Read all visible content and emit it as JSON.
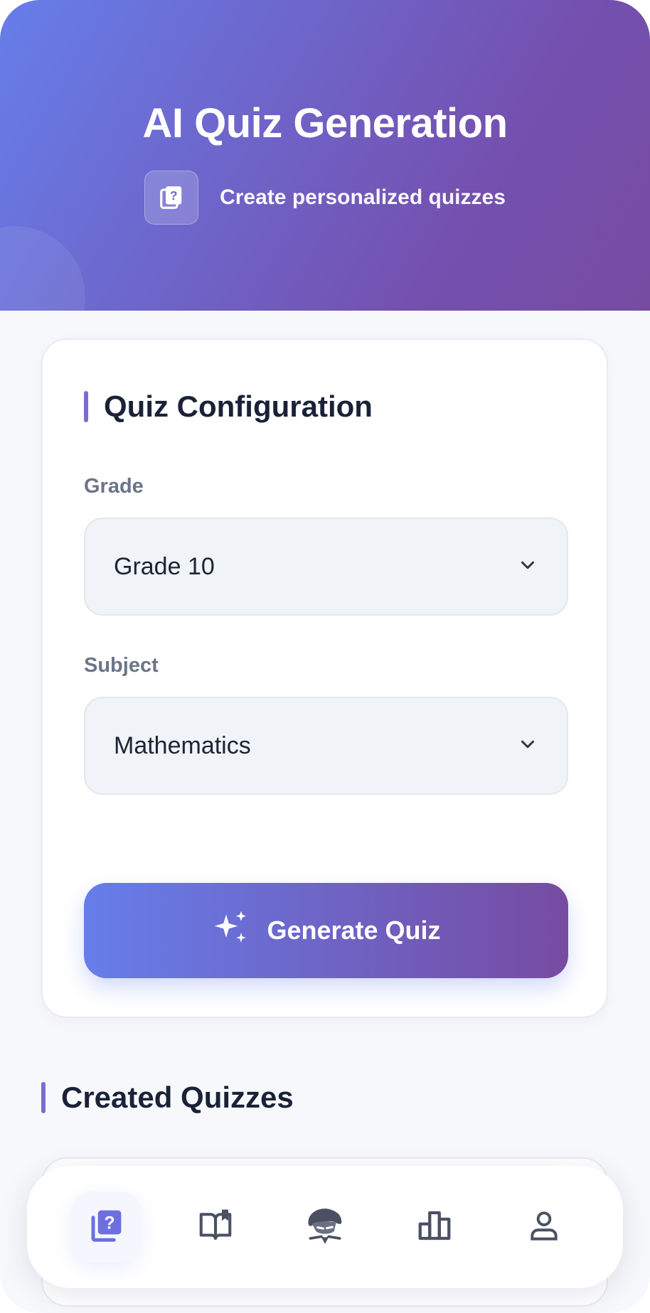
{
  "header": {
    "title": "AI Quiz Generation",
    "subtitle": "Create personalized quizzes",
    "icon": "quiz-icon"
  },
  "config": {
    "section_title": "Quiz Configuration",
    "grade": {
      "label": "Grade",
      "value": "Grade 10"
    },
    "subject": {
      "label": "Subject",
      "value": "Mathematics"
    },
    "generate_label": "Generate Quiz",
    "generate_icon": "sparkles-icon"
  },
  "created": {
    "section_title": "Created Quizzes"
  },
  "bottom_nav": {
    "items": [
      {
        "icon": "quiz-icon",
        "active": true
      },
      {
        "icon": "book-icon",
        "active": false
      },
      {
        "icon": "mascot-icon",
        "active": false
      },
      {
        "icon": "leaderboard-icon",
        "active": false
      },
      {
        "icon": "profile-icon",
        "active": false
      }
    ]
  },
  "colors": {
    "gradient_start": "#667eea",
    "gradient_end": "#764ba2",
    "accent": "#7b6cd0",
    "active_nav": "#6b6fe0"
  }
}
